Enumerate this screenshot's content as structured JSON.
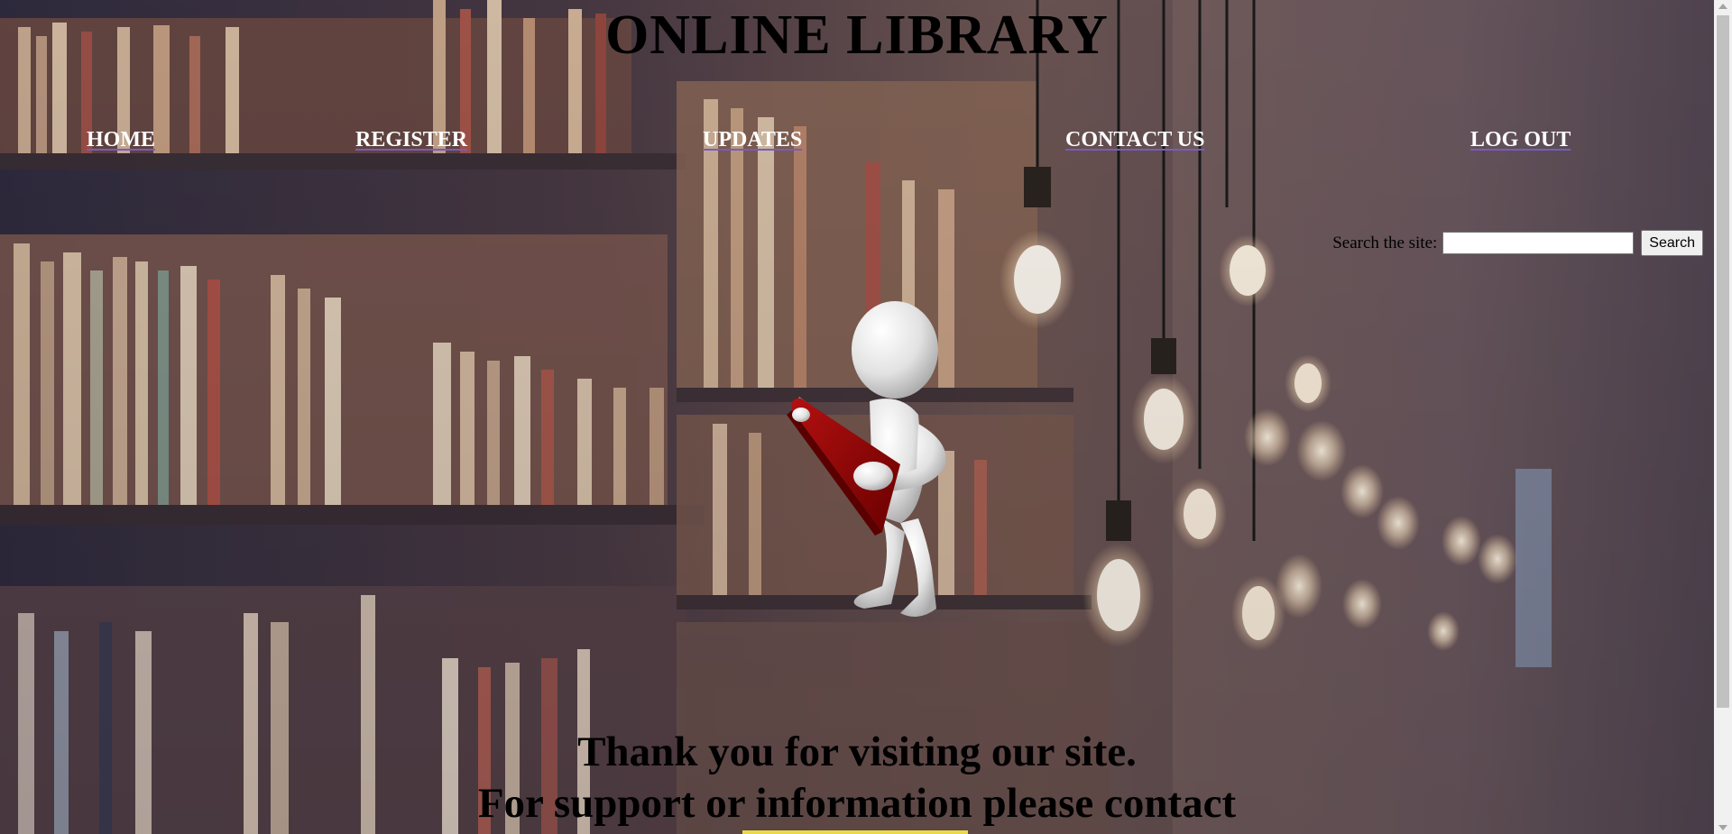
{
  "header": {
    "title": "ONLINE LIBRARY"
  },
  "nav": {
    "items": [
      {
        "label": "HOME"
      },
      {
        "label": "REGISTER"
      },
      {
        "label": "UPDATES"
      },
      {
        "label": "CONTACT US"
      },
      {
        "label": "LOG OUT"
      }
    ]
  },
  "search": {
    "label": "Search the site:",
    "value": "",
    "button_label": "Search"
  },
  "hero": {
    "image": "stick-figure-reading-red-book",
    "background": "library-bookshelves-with-hanging-light-bulbs"
  },
  "footer": {
    "line1": "Thank you for visiting our site.",
    "line2": "For support or information please contact"
  },
  "colors": {
    "nav_text": "#ffffff",
    "title_text": "#000000",
    "book_red": "#8b0000",
    "link_underline": "#7a5bbf"
  }
}
